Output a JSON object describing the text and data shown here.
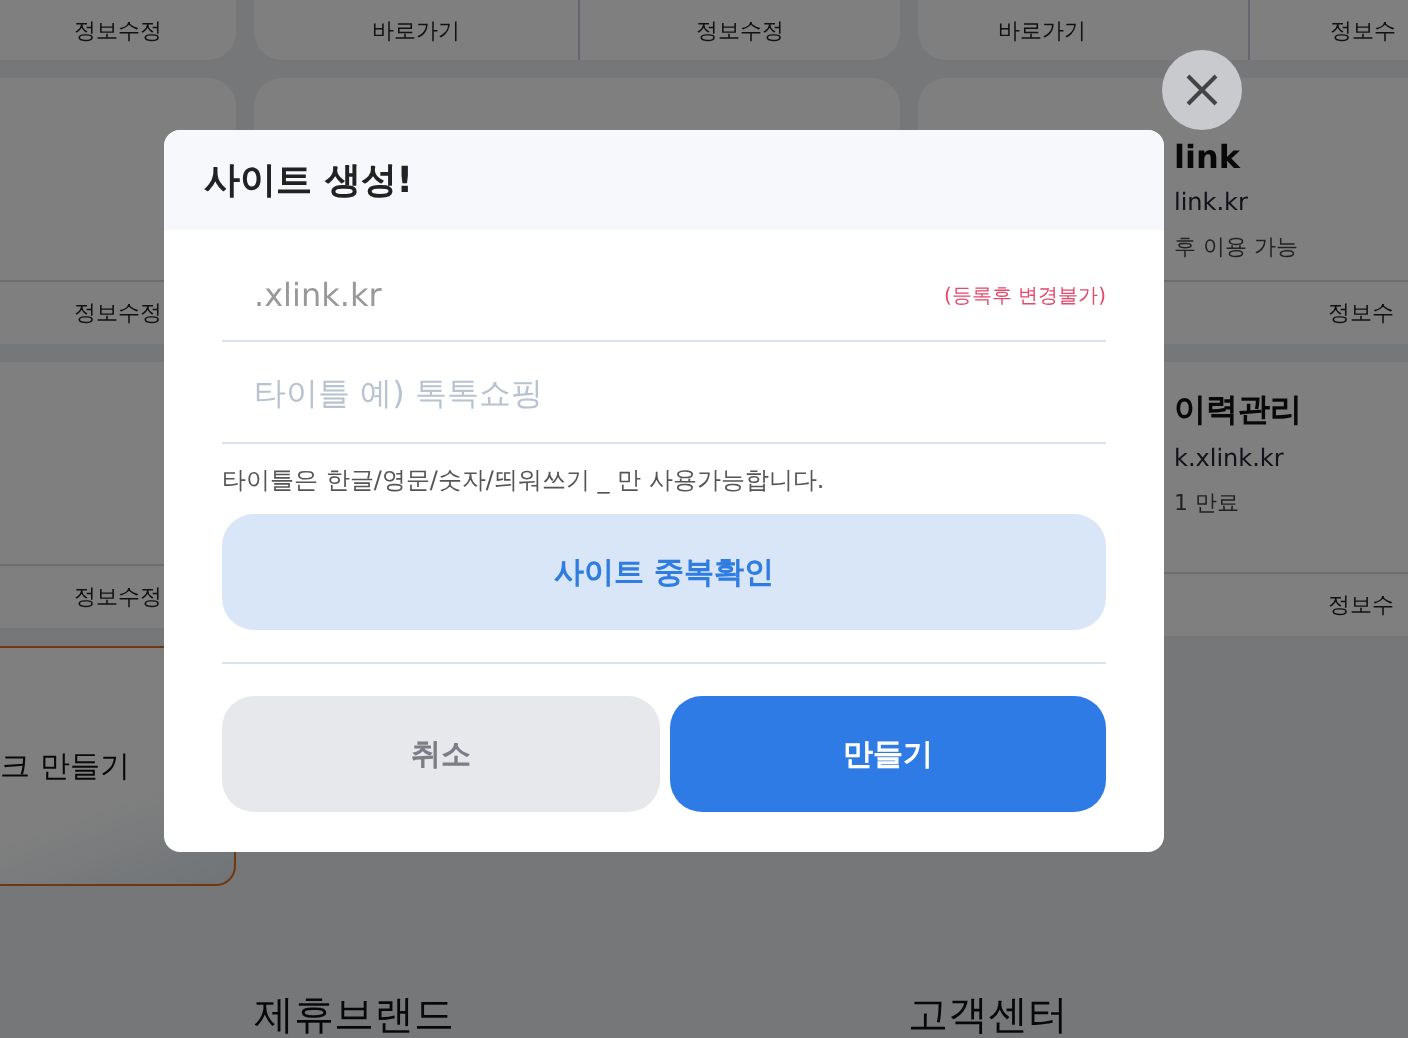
{
  "background": {
    "columns": [
      {
        "cards": [
          {
            "kind": "footer",
            "footer": [
              "정보수정"
            ]
          },
          {
            "kind": "plain",
            "footer": [
              "정보수정"
            ]
          },
          {
            "kind": "plain",
            "footer": [
              "정보수정"
            ]
          },
          {
            "kind": "promo",
            "text": "크 만들기"
          }
        ]
      },
      {
        "cards": [
          {
            "kind": "footer",
            "footer": [
              "바로가기",
              "정보수정"
            ]
          },
          {
            "kind": "plain"
          }
        ]
      },
      {
        "cards": [
          {
            "kind": "footer",
            "footer": [
              "바로가기",
              "정보수"
            ]
          },
          {
            "kind": "site",
            "title": "link",
            "url": "link.kr",
            "note": "후 이용 가능",
            "footer": [
              "정보수"
            ]
          },
          {
            "kind": "site",
            "title": "이력관리",
            "url": "k.xlink.kr",
            "note": "1 만료",
            "footer": [
              "정보수"
            ]
          }
        ]
      }
    ],
    "sections": [
      "제휴브랜드",
      "고객센터"
    ]
  },
  "dialog": {
    "title": "사이트 생성!",
    "domain": {
      "value": ".xlink.kr",
      "note": "(등록후 변경불가)"
    },
    "title_field": {
      "placeholder": "타이틀 예) 톡톡쇼핑"
    },
    "hint": "타이틀은 한글/영문/숫자/띄워쓰기 _ 만 사용가능합니다.",
    "check_button": "사이트 중복확인",
    "cancel_button": "취소",
    "create_button": "만들기"
  }
}
